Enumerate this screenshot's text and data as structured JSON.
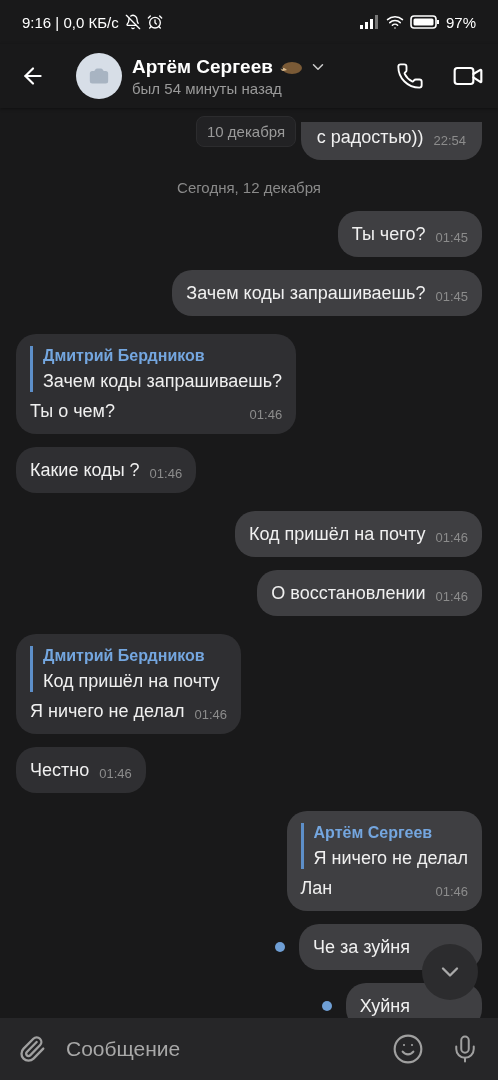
{
  "status_bar": {
    "time": "9:16 | 0,0 КБ/с",
    "battery": "97%"
  },
  "header": {
    "name": "Артём Сергеев",
    "subtitle": "был 54 минуты назад"
  },
  "floating_date": "10 декабря",
  "messages": [
    {
      "kind": "message",
      "outgoing": true,
      "unread": false,
      "cut_top": true,
      "text": "с радостью))",
      "time": "22:54"
    },
    {
      "kind": "date",
      "text": "Сегодня, 12 декабря"
    },
    {
      "kind": "message",
      "outgoing": true,
      "unread": false,
      "text": "Ты чего?",
      "time": "01:45"
    },
    {
      "kind": "message",
      "outgoing": true,
      "unread": false,
      "text": "Зачем коды запрашиваешь?",
      "time": "01:45"
    },
    {
      "kind": "message",
      "outgoing": false,
      "reply": {
        "author": "Дмитрий Бердников",
        "text": "Зачем коды запрашиваешь?"
      },
      "text": "Ты о чем?",
      "time": "01:46"
    },
    {
      "kind": "message",
      "outgoing": false,
      "text": "Какие коды ?",
      "time": "01:46"
    },
    {
      "kind": "message",
      "outgoing": true,
      "unread": false,
      "text": "Код пришёл на почту",
      "time": "01:46"
    },
    {
      "kind": "message",
      "outgoing": true,
      "unread": false,
      "text": "О восстановлении",
      "time": "01:46"
    },
    {
      "kind": "message",
      "outgoing": false,
      "reply": {
        "author": "Дмитрий Бердников",
        "text": "Код пришёл на почту"
      },
      "text": "Я ничего не делал",
      "time": "01:46"
    },
    {
      "kind": "message",
      "outgoing": false,
      "text": "Честно",
      "time": "01:46"
    },
    {
      "kind": "message",
      "outgoing": true,
      "unread": false,
      "reply": {
        "author": "Артём Сергеев",
        "text": "Я ничего не делал"
      },
      "text": "Лан",
      "time": "01:46"
    },
    {
      "kind": "message",
      "outgoing": true,
      "unread": true,
      "text": "Че за зуйня"
    },
    {
      "kind": "message",
      "outgoing": true,
      "unread": true,
      "text": "Хуйня"
    }
  ],
  "composer": {
    "placeholder": "Сообщение"
  }
}
